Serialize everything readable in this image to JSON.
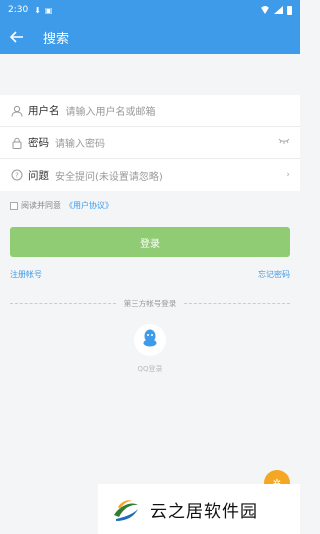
{
  "status_bar": {
    "time": "2:30"
  },
  "header": {
    "title": "搜索"
  },
  "form": {
    "username": {
      "label": "用户名",
      "placeholder": "请输入用户名或邮箱"
    },
    "password": {
      "label": "密码",
      "placeholder": "请输入密码"
    },
    "question": {
      "label": "问题",
      "value": "安全提问(未设置请忽略)"
    }
  },
  "agreement": {
    "text": "阅读并同意",
    "link": "《用户协议》"
  },
  "login_button": "登录",
  "links": {
    "register": "注册帐号",
    "forgot": "忘记密码"
  },
  "third_party": {
    "title": "第三方帐号登录",
    "qq_label": "QQ登录"
  },
  "watermark": {
    "text": "云之居软件园"
  },
  "colors": {
    "accent": "#3d9be9",
    "login_button": "#90cc73",
    "fab": "#f5a623"
  },
  "icons": [
    "back-arrow-icon",
    "user-icon",
    "lock-icon",
    "question-icon",
    "eye-closed-icon",
    "chevron-right-icon",
    "qq-icon"
  ]
}
